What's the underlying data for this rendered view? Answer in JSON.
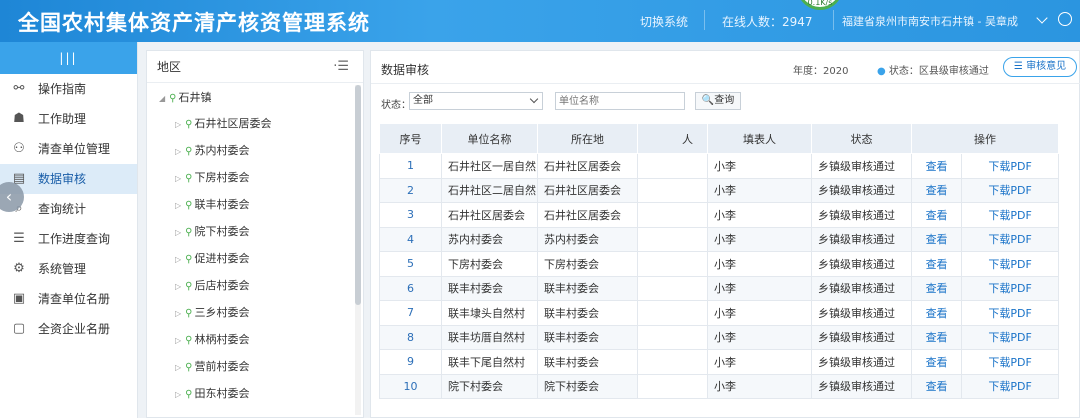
{
  "header": {
    "app_title": "全国农村集体资产清产核资管理系统",
    "switch_label": "切换系统",
    "online_label": "在线人数：2947",
    "speed": "0.1K/s",
    "location": "福建省泉州市南安市石井镇 - 吴章成"
  },
  "sidebar": {
    "collapse_label": "|||",
    "items": [
      {
        "label": "操作指南",
        "icon": "guide-icon"
      },
      {
        "label": "工作助理",
        "icon": "assistant-icon"
      },
      {
        "label": "清查单位管理",
        "icon": "unit-manage-icon"
      },
      {
        "label": "数据审核",
        "icon": "data-audit-icon",
        "active": true
      },
      {
        "label": "查询统计",
        "icon": "stats-icon"
      },
      {
        "label": "工作进度查询",
        "icon": "progress-icon"
      },
      {
        "label": "系统管理",
        "icon": "gear-icon"
      },
      {
        "label": "清查单位名册",
        "icon": "roster-icon"
      },
      {
        "label": "全资企业名册",
        "icon": "enterprise-icon"
      }
    ]
  },
  "region": {
    "title": "地区",
    "root": "石井镇",
    "children": [
      "石井社区居委会",
      "苏内村委会",
      "下房村委会",
      "联丰村委会",
      "院下村委会",
      "促进村委会",
      "后店村委会",
      "三乡村委会",
      "林柄村委会",
      "营前村委会",
      "田东村委会"
    ]
  },
  "main": {
    "title": "数据审核",
    "year": "年度：2020",
    "status": "状态：区县级审核通过",
    "opinion_btn": "审核意见",
    "filter": {
      "status_label": "状态：",
      "status_value": "全部",
      "unit_placeholder": "单位名称",
      "query_btn": "查询"
    },
    "table": {
      "headers": [
        "序号",
        "单位名称",
        "所在地",
        "人",
        "填表人",
        "状态",
        "操作"
      ],
      "rows": [
        {
          "no": "1",
          "name": "石井社区一居自然",
          "loc": "石井社区居委会",
          "filler": "小李",
          "status": "乡镇级审核通过",
          "view": "查看",
          "pdf": "下载PDF"
        },
        {
          "no": "2",
          "name": "石井社区二居自然",
          "loc": "石井社区居委会",
          "filler": "小李",
          "status": "乡镇级审核通过",
          "view": "查看",
          "pdf": "下载PDF"
        },
        {
          "no": "3",
          "name": "石井社区居委会",
          "loc": "石井社区居委会",
          "filler": "小李",
          "status": "乡镇级审核通过",
          "view": "查看",
          "pdf": "下载PDF"
        },
        {
          "no": "4",
          "name": "苏内村委会",
          "loc": "苏内村委会",
          "filler": "小李",
          "status": "乡镇级审核通过",
          "view": "查看",
          "pdf": "下载PDF"
        },
        {
          "no": "5",
          "name": "下房村委会",
          "loc": "下房村委会",
          "filler": "小李",
          "status": "乡镇级审核通过",
          "view": "查看",
          "pdf": "下载PDF"
        },
        {
          "no": "6",
          "name": "联丰村委会",
          "loc": "联丰村委会",
          "filler": "小李",
          "status": "乡镇级审核通过",
          "view": "查看",
          "pdf": "下载PDF"
        },
        {
          "no": "7",
          "name": "联丰埭头自然村",
          "loc": "联丰村委会",
          "filler": "小李",
          "status": "乡镇级审核通过",
          "view": "查看",
          "pdf": "下载PDF"
        },
        {
          "no": "8",
          "name": "联丰坊厝自然村",
          "loc": "联丰村委会",
          "filler": "小李",
          "status": "乡镇级审核通过",
          "view": "查看",
          "pdf": "下载PDF"
        },
        {
          "no": "9",
          "name": "联丰下尾自然村",
          "loc": "联丰村委会",
          "filler": "小李",
          "status": "乡镇级审核通过",
          "view": "查看",
          "pdf": "下载PDF"
        },
        {
          "no": "10",
          "name": "院下村委会",
          "loc": "院下村委会",
          "filler": "小李",
          "status": "乡镇级审核通过",
          "view": "查看",
          "pdf": "下载PDF"
        }
      ]
    }
  }
}
